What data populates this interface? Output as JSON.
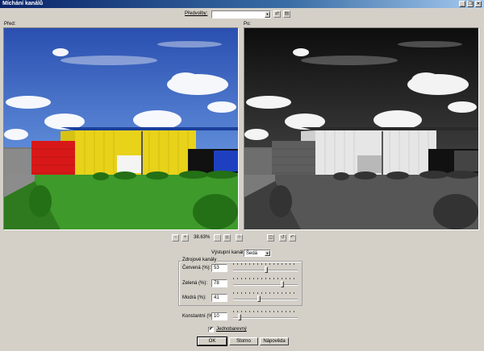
{
  "window": {
    "title": "Míchání kanálů",
    "minimize": "_",
    "restore": "❐",
    "close": "✕"
  },
  "presets": {
    "label": "Předvolby:",
    "value": ""
  },
  "panels": {
    "before_label": "Před:",
    "after_label": "Po:"
  },
  "zoom": {
    "value": "38.63%"
  },
  "output": {
    "label": "Výstupní kanál:",
    "value": "Šedá"
  },
  "source_group": {
    "title": "Zdrojové kanály",
    "channels": [
      {
        "label": "Červená (%):",
        "value": "53",
        "level_percent": 53
      },
      {
        "label": "Zelená (%):",
        "value": "78",
        "level_percent": 78
      },
      {
        "label": "Modrá (%):",
        "value": "41",
        "level_percent": 41
      }
    ]
  },
  "constant": {
    "label": "Konstantní (%):",
    "value": "10",
    "level_percent": 10
  },
  "monochrome": {
    "label": "Jednobarevný",
    "checked": true,
    "mark": "✔"
  },
  "buttons": {
    "ok": "OK",
    "cancel": "Storno",
    "help": "Nápověda"
  },
  "icons": {
    "zoom_in": "+",
    "zoom_out": "−",
    "fit": "□",
    "actual": "▣",
    "pan": "✥",
    "split_view": "◫",
    "reset": "↺",
    "undo": "↶",
    "presets_load": "⇄",
    "presets_save": "▤"
  },
  "colors": {
    "titlebar": "#0a246a",
    "dialog_bg": "#d4d0c8"
  }
}
